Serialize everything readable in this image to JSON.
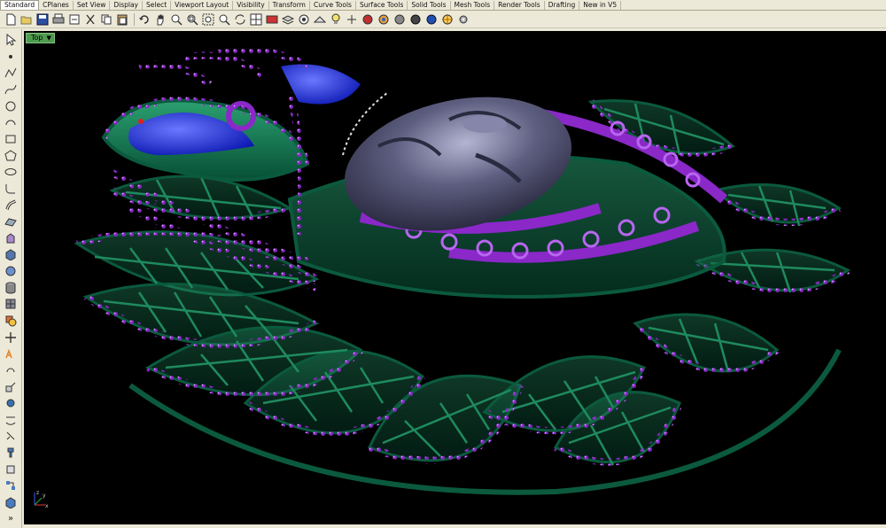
{
  "tabs": [
    "Standard",
    "CPlanes",
    "Set View",
    "Display",
    "Select",
    "Viewport Layout",
    "Visibility",
    "Transform",
    "Curve Tools",
    "Surface Tools",
    "Solid Tools",
    "Mesh Tools",
    "Render Tools",
    "Drafting",
    "New in V5"
  ],
  "viewport": {
    "name": "Top"
  },
  "axis_labels": {
    "x": "x",
    "y": "y",
    "z": "z"
  },
  "left_expand": "»",
  "colors": {
    "tab_bg": "#ece9d8",
    "viewport_bg": "#000000",
    "label_green": "#4f9a4f",
    "frame_green": "#0e6a4a",
    "gem_purple": "#8a28c8",
    "face_gray": "#5a5a78",
    "accent_blue": "#1a2ad8"
  },
  "toolbar_icons": [
    "new-file-icon",
    "open-folder-icon",
    "save-icon",
    "print-icon",
    "import-icon",
    "cut-icon",
    "copy-icon",
    "paste-icon",
    "undo-icon",
    "pan-hand-icon",
    "zoom-icon",
    "zoom-window-icon",
    "zoom-extents-icon",
    "zoom-selected-icon",
    "rotate-view-icon",
    "four-view-icon",
    "named-views-icon",
    "layer-icon",
    "object-properties-icon",
    "cplane-icon",
    "light-bulb-icon",
    "shaded-icon",
    "rendered-icon",
    "color-wheel-icon",
    "sphere-icon",
    "material-icon",
    "render-icon",
    "environment-icon",
    "settings-icon"
  ],
  "left_icons": [
    "select-arrow-icon",
    "point-icon",
    "polyline-icon",
    "curve-icon",
    "circle-icon",
    "arc-icon",
    "rectangle-icon",
    "polygon-icon",
    "ellipse-icon",
    "fillet-curve-icon",
    "offset-icon",
    "surface-icon",
    "extrude-icon",
    "solid-box-icon",
    "sphere-solid-icon",
    "cylinder-icon",
    "mesh-icon",
    "boolean-icon",
    "move-icon",
    "copy-obj-icon",
    "rotate-obj-icon",
    "scale-icon",
    "mirror-icon",
    "array-icon",
    "dimension-icon",
    "group-icon",
    "block-icon",
    "analyze-icon",
    "render-obj-icon"
  ]
}
